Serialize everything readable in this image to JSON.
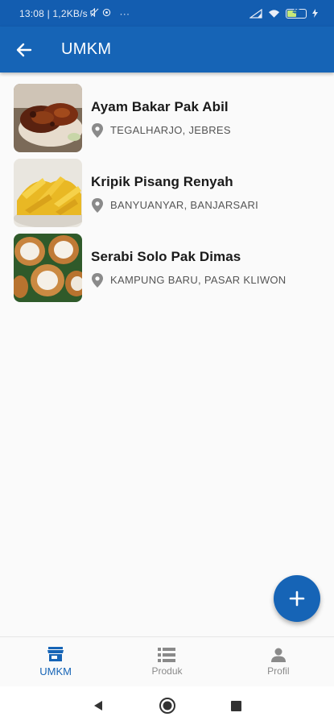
{
  "status_bar": {
    "time_net": "13:08 | 1,2KB/s",
    "more": "···",
    "battery": "48"
  },
  "app_bar": {
    "title": "UMKM",
    "back_icon": "arrow-left-icon"
  },
  "items": [
    {
      "name": "Ayam Bakar Pak Abil",
      "address": "TEGALHARJO, JEBRES",
      "image": "grilled-chicken-photo"
    },
    {
      "name": "Kripik Pisang Renyah",
      "address": "BANYUANYAR, BANJARSARI",
      "image": "banana-chips-photo"
    },
    {
      "name": "Serabi Solo Pak Dimas",
      "address": "KAMPUNG BARU, PASAR KLIWON",
      "image": "serabi-pancake-photo"
    }
  ],
  "fab": {
    "icon": "plus-icon"
  },
  "bottom_nav": [
    {
      "label": "UMKM",
      "icon": "store-icon",
      "active": true
    },
    {
      "label": "Produk",
      "icon": "list-icon",
      "active": false
    },
    {
      "label": "Profil",
      "icon": "person-icon",
      "active": false
    }
  ],
  "colors": {
    "primary": "#1664b6",
    "status_bar": "#135db0",
    "inactive": "#8a8a8a"
  }
}
